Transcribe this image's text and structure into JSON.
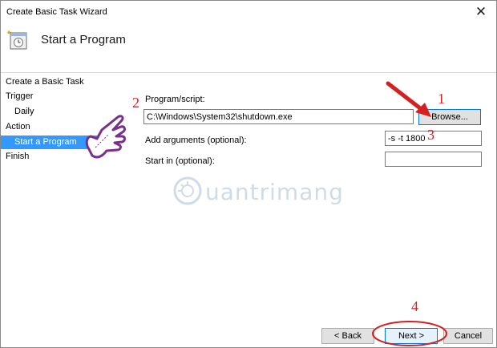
{
  "window": {
    "title": "Create Basic Task Wizard",
    "close_glyph": "✕"
  },
  "header": {
    "title": "Start a Program",
    "icon": "task-clock-icon"
  },
  "sidebar": {
    "items": [
      {
        "label": "Create a Basic Task",
        "level": "top",
        "selected": false
      },
      {
        "label": "Trigger",
        "level": "top",
        "selected": false
      },
      {
        "label": "Daily",
        "level": "sub",
        "selected": false
      },
      {
        "label": "Action",
        "level": "top",
        "selected": false
      },
      {
        "label": "Start a Program",
        "level": "sub",
        "selected": true
      },
      {
        "label": "Finish",
        "level": "top",
        "selected": false
      }
    ]
  },
  "form": {
    "program_label": "Program/script:",
    "program_value": "C:\\Windows\\System32\\shutdown.exe",
    "browse_label": "Browse...",
    "args_label": "Add arguments (optional):",
    "args_value": "-s -t 1800",
    "startin_label": "Start in (optional):",
    "startin_value": ""
  },
  "footer": {
    "back_label": "< Back",
    "next_label": "Next >",
    "cancel_label": "Cancel"
  },
  "annotations": {
    "n1": "1",
    "n2": "2",
    "n3": "3",
    "n4": "4",
    "color": "#d42020"
  },
  "watermark": {
    "text": "uantrimang",
    "icon": "quantrimang-logo-icon"
  },
  "colors": {
    "selection": "#3399ff",
    "focus_border": "#0078d7"
  }
}
